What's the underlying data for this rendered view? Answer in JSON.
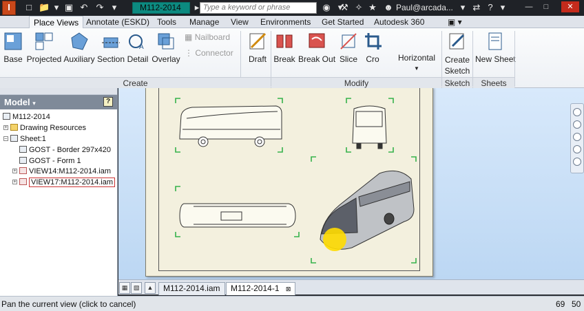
{
  "title_bar": {
    "app_logo": "I",
    "document_title": "M112-2014",
    "search_placeholder": "Type a keyword or phrase",
    "user": "Paul@arcada...",
    "icons": [
      "new-icon",
      "open-icon",
      "save-icon",
      "undo-icon",
      "redo-icon",
      "search-icon",
      "binoculars-icon",
      "wrench-icon",
      "tools-icon",
      "star-icon",
      "user-icon",
      "exchange-icon",
      "help-icon",
      "minimize-icon",
      "maximize-icon",
      "close-icon"
    ]
  },
  "ribbon_tabs": [
    "Place Views",
    "Annotate (ESKD)",
    "Tools",
    "Manage",
    "View",
    "Environments",
    "Get Started",
    "Autodesk 360"
  ],
  "ribbon": {
    "create": {
      "label": "Create",
      "buttons": [
        "Base",
        "Projected",
        "Auxiliary",
        "Section",
        "Detail",
        "Overlay"
      ],
      "small_buttons": [
        "Nailboard",
        "Connector"
      ],
      "draft": "Draft"
    },
    "modify": {
      "label": "Modify",
      "buttons": [
        "Break",
        "Break Out",
        "Slice",
        "Cro"
      ],
      "arrange": "Horizontal"
    },
    "sketch": {
      "label": "Sketch",
      "button_line1": "Create",
      "button_line2": "Sketch"
    },
    "sheets": {
      "label": "Sheets",
      "button": "New Sheet"
    }
  },
  "browser": {
    "header": "Model",
    "help_glyph": "?",
    "tree": [
      {
        "label": "M112-2014",
        "level": 0
      },
      {
        "label": "Drawing Resources",
        "level": 1
      },
      {
        "label": "Sheet:1",
        "level": 1
      },
      {
        "label": "GOST - Border 297x420",
        "level": 2
      },
      {
        "label": "GOST - Form 1",
        "level": 2
      },
      {
        "label": "VIEW14:M112-2014.iam",
        "level": 2
      },
      {
        "label": "VIEW17:M112-2014.iam",
        "level": 2
      }
    ]
  },
  "doc_tabs": [
    "M112-2014.iam",
    "M112-2014-1"
  ],
  "status_bar": {
    "message": "Pan the current view (click to cancel)",
    "num1": "69",
    "num2": "50"
  },
  "colors": {
    "title_bar": "#1f2227",
    "doc_title_bg": "#0c8a80",
    "canvas_bg": "#c9dff7",
    "sheet_bg": "#f3f0de",
    "cursor_highlight": "#ffdc00",
    "browser_header": "#7f8a99"
  }
}
